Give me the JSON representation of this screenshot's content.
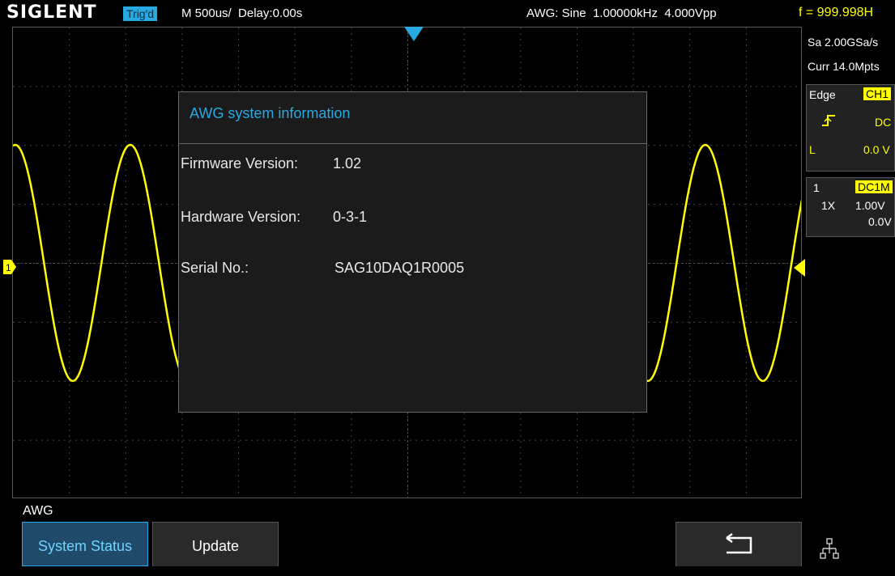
{
  "header": {
    "logo": "SIGLENT",
    "trigger_status": "Trig'd",
    "timebase": "M 500us/",
    "delay": "Delay:0.00s",
    "awg_summary": "AWG: Sine  1.00000kHz  4.000Vpp",
    "frequency_readout": "f = 999.998H"
  },
  "side_panel": {
    "sample_rate": "Sa 2.00GSa/s",
    "memory": "Curr 14.0Mpts",
    "trigger": {
      "type": "Edge",
      "source": "CH1",
      "coupling": "DC",
      "level_label": "L",
      "level": "0.0 V"
    },
    "channel": {
      "number": "1",
      "coupling": "DC1M",
      "probe": "1X",
      "scale": "1.00V",
      "offset": "0.0V"
    }
  },
  "markers": {
    "channel": "1"
  },
  "dialog": {
    "title": "AWG system information",
    "rows": [
      {
        "label": "Firmware Version:",
        "value": "1.02"
      },
      {
        "label": "Hardware Version:",
        "value": "0-3-1"
      },
      {
        "label": "Serial No.:",
        "value": "SAG10DAQ1R0005"
      }
    ]
  },
  "menu": {
    "title": "AWG",
    "softkeys": [
      "System Status",
      "Update"
    ]
  },
  "icons": {
    "back": "return-arrow-icon",
    "network": "network-icon"
  },
  "colors": {
    "trace": "#ffff00",
    "accent": "#29a9e1"
  }
}
